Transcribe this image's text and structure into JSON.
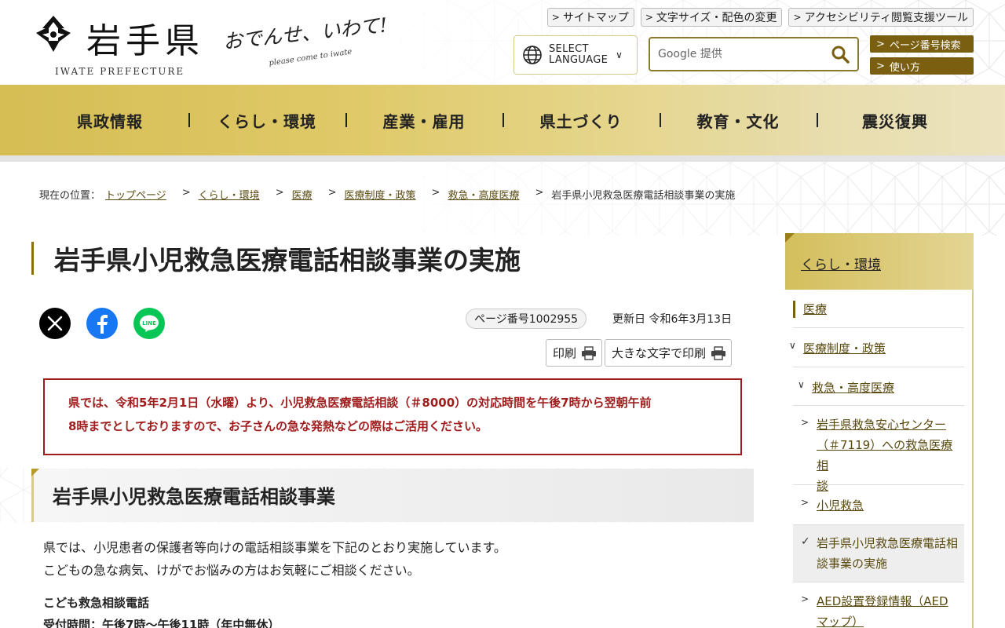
{
  "header": {
    "logo_name": "岩手県",
    "logo_en": "IWATE PREFECTURE",
    "catch_main": "おでんせ、いわて!",
    "catch_sub": "please come to iwate",
    "top_links": [
      "サイトマップ",
      "文字サイズ・配色の変更",
      "アクセシビリティ閲覧支援ツール"
    ],
    "language_label_1": "SELECT",
    "language_label_2": "LANGUAGE",
    "search_placeholder": "Google 提供",
    "page_number_search": "ページ番号検索",
    "how_to_use": "使い方"
  },
  "global_nav": [
    "県政情報",
    "くらし・環境",
    "産業・雇用",
    "県土づくり",
    "教育・文化",
    "震災復興"
  ],
  "breadcrumb": {
    "label": "現在の位置：",
    "links": [
      "トップページ",
      "くらし・環境",
      "医療",
      "医療制度・政策",
      "救急・高度医療"
    ],
    "current": "岩手県小児救急医療電話相談事業の実施"
  },
  "page": {
    "title": "岩手県小児救急医療電話相談事業の実施",
    "page_number": "ページ番号1002955",
    "updated": "更新日 令和6年3月13日",
    "print": "印刷",
    "print_large": "大きな文字で印刷",
    "notice_line1": "県では、令和5年2月1日（水曜）より、小児救急医療電話相談（＃8000）の対応時間を午後7時から翌朝午前",
    "notice_line2": "8時までとしておりますので、お子さんの急な発熱などの際はご活用ください。",
    "section_heading": "岩手県小児救急医療電話相談事業",
    "body_line1": "県では、小児患者の保護者等向けの電話相談事業を下記のとおり実施しています。",
    "body_line2": "こどもの急な病気、けがでお悩みの方はお気軽にご相談ください。",
    "subhead1": "こども救急相談電話",
    "subhead2": "受付時間：午後7時～午後11時（年中無休）"
  },
  "social": [
    "x-share",
    "facebook-share",
    "line-share"
  ],
  "side_nav": {
    "heading": "くらし・環境",
    "level1": "医療",
    "level2": "医療制度・政策",
    "level3": "救急・高度医療",
    "items": [
      {
        "label_1": "岩手県救急安心センター",
        "label_2": "（＃7119）への救急医療相",
        "label_3": "談"
      },
      {
        "label_1": "小児救急"
      },
      {
        "label_1": "岩手県小児救急医療電話相",
        "label_2": "談事業の実施"
      },
      {
        "label_1": "AED設置登録情報（AED",
        "label_2": "マップ）"
      }
    ]
  },
  "colors": {
    "gold": "#d6bd54",
    "brown": "#7a5f10",
    "notice_red": "#a01d1d"
  }
}
